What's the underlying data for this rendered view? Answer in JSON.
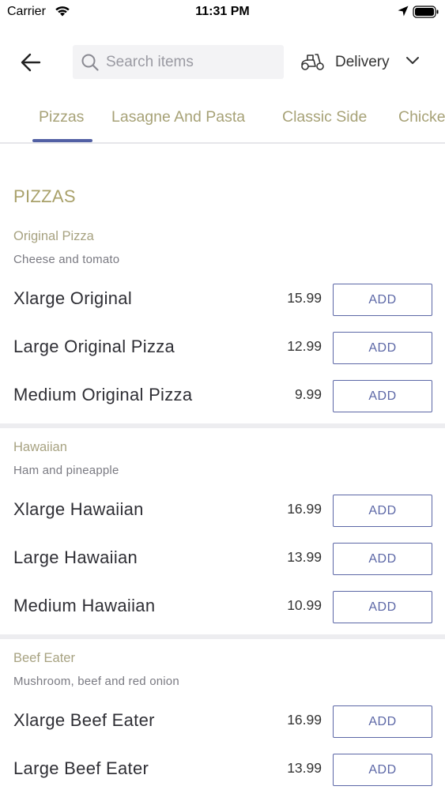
{
  "status_bar": {
    "carrier": "Carrier",
    "time": "11:31 PM"
  },
  "header": {
    "search_placeholder": "Search items",
    "search_value": "",
    "delivery_label": "Delivery"
  },
  "tabs": [
    {
      "label": "Pizzas",
      "active": true
    },
    {
      "label": "Lasagne And Pasta",
      "active": false
    },
    {
      "label": "Classic Side",
      "active": false
    },
    {
      "label": "Chicke",
      "active": false
    }
  ],
  "section": {
    "title": "PIZZAS"
  },
  "groups": [
    {
      "name": "Original Pizza",
      "description": "Cheese and tomato",
      "items": [
        {
          "name": "Xlarge Original",
          "price": "15.99",
          "button": "ADD"
        },
        {
          "name": "Large Original Pizza",
          "price": "12.99",
          "button": "ADD"
        },
        {
          "name": "Medium Original Pizza",
          "price": "9.99",
          "button": "ADD"
        }
      ]
    },
    {
      "name": "Hawaiian",
      "description": "Ham and pineapple",
      "items": [
        {
          "name": "Xlarge Hawaiian",
          "price": "16.99",
          "button": "ADD"
        },
        {
          "name": "Large Hawaiian",
          "price": "13.99",
          "button": "ADD"
        },
        {
          "name": "Medium Hawaiian",
          "price": "10.99",
          "button": "ADD"
        }
      ]
    },
    {
      "name": "Beef Eater",
      "description": "Mushroom, beef and red onion",
      "items": [
        {
          "name": "Xlarge Beef Eater",
          "price": "16.99",
          "button": "ADD"
        },
        {
          "name": "Large Beef Eater",
          "price": "13.99",
          "button": "ADD"
        }
      ]
    }
  ],
  "colors": {
    "accent": "#5260a4",
    "section_title": "#a9a16a",
    "tab_text": "#a7a277",
    "divider": "#ededf0"
  },
  "icons": [
    "wifi-icon",
    "location-arrow-icon",
    "battery-icon",
    "back-arrow-icon",
    "search-icon",
    "scooter-icon",
    "chevron-down-icon"
  ]
}
